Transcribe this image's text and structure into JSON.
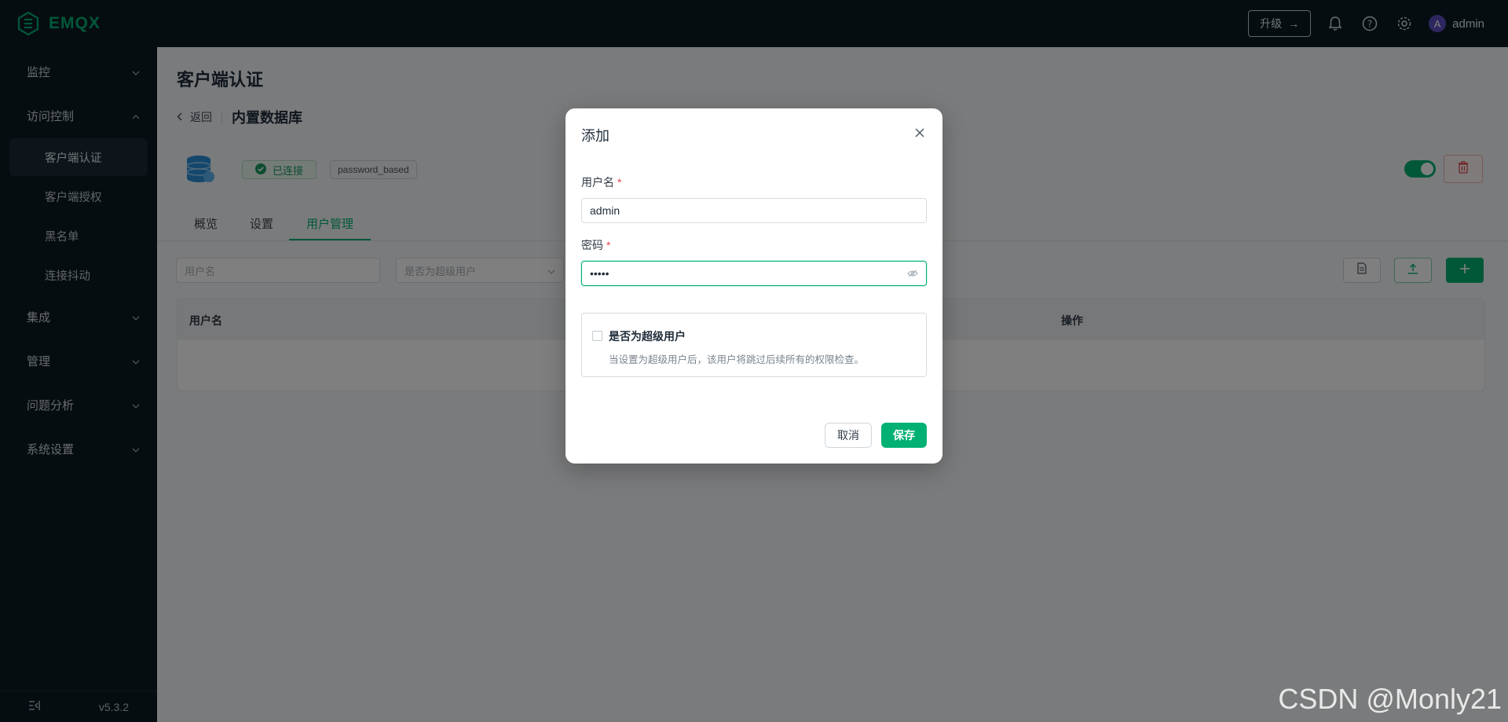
{
  "app": {
    "logo_text": "EMQX"
  },
  "header": {
    "upgrade_label": "升级",
    "user_initial": "A",
    "username": "admin"
  },
  "sidebar": {
    "groups": [
      {
        "label": "监控"
      },
      {
        "label": "访问控制"
      },
      {
        "label": "集成"
      },
      {
        "label": "管理"
      },
      {
        "label": "问题分析"
      },
      {
        "label": "系统设置"
      }
    ],
    "access_items": [
      {
        "label": "客户端认证"
      },
      {
        "label": "客户端授权"
      },
      {
        "label": "黑名单"
      },
      {
        "label": "连接抖动"
      }
    ],
    "version": "v5.3.2"
  },
  "page": {
    "title": "客户端认证",
    "back_label": "返回",
    "db_name": "内置数据库",
    "status_label": "已连接",
    "mechanism": "password_based",
    "enabled": true,
    "tabs": [
      {
        "label": "概览"
      },
      {
        "label": "设置"
      },
      {
        "label": "用户管理"
      }
    ],
    "active_tab": "用户管理",
    "filters": {
      "username_placeholder": "用户名",
      "superuser_placeholder": "是否为超级用户"
    },
    "table_headers": {
      "username": "用户名",
      "actions": "操作"
    }
  },
  "modal": {
    "title": "添加",
    "username_label": "用户名",
    "username_value": "admin",
    "password_label": "密码",
    "password_value": "•••••",
    "superuser_label": "是否为超级用户",
    "superuser_checked": false,
    "superuser_hint": "当设置为超级用户后，该用户将跳过后续所有的权限检查。",
    "cancel_label": "取消",
    "save_label": "保存"
  },
  "watermark": "CSDN @Monly21",
  "colors": {
    "brand": "#00b173",
    "danger": "#e5484d",
    "sidebar_bg": "#0c1a23"
  }
}
